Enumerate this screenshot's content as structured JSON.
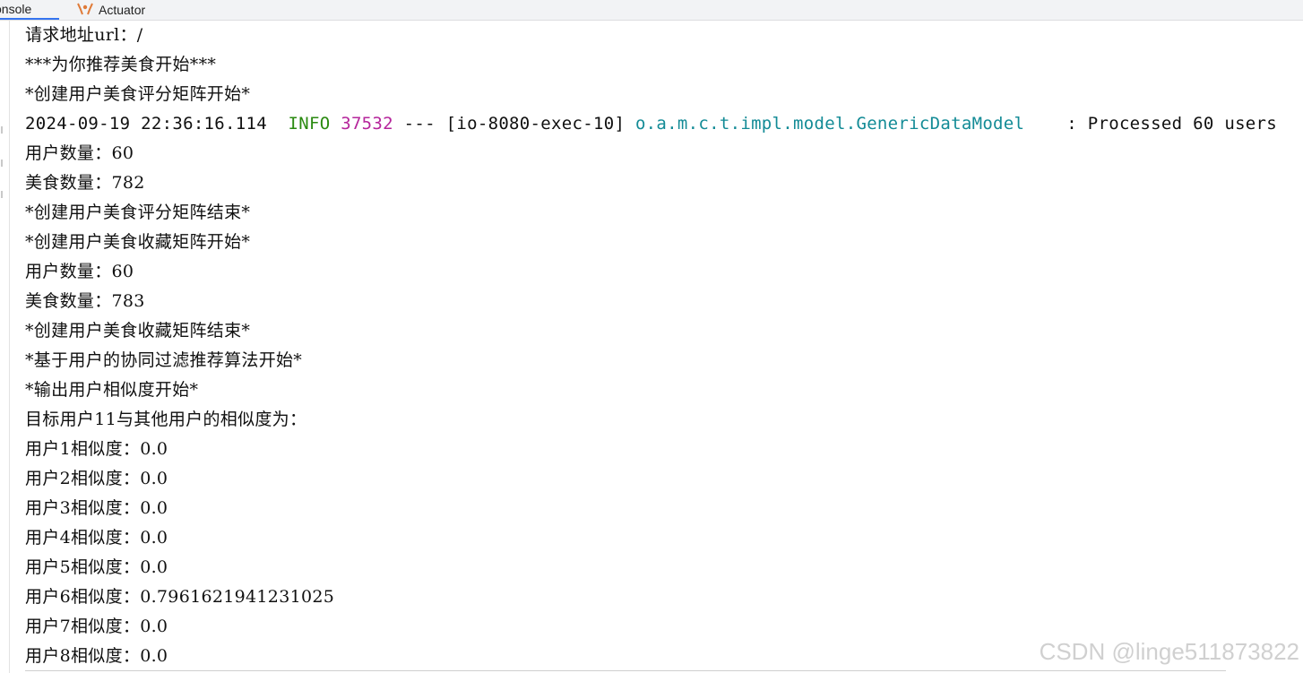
{
  "tabs": {
    "console_label": "onsole",
    "actuator_label": "Actuator"
  },
  "colors": {
    "info": "#2a8a10",
    "pid": "#b5259b",
    "logger": "#138b96",
    "tab_underline": "#3574f0"
  },
  "console": {
    "lines": [
      "请求地址url：/",
      "***为你推荐美食开始***",
      "*创建用户美食评分矩阵开始*",
      {
        "timestamp": "2024-09-19 22:36:16.114",
        "level": "INFO",
        "pid": "37532",
        "sep": "---",
        "thread": "[io-8080-exec-10]",
        "logger": "o.a.m.c.t.impl.model.GenericDataModel",
        "message": ": Processed 60 users"
      },
      "用户数量：60",
      "美食数量：782",
      "*创建用户美食评分矩阵结束*",
      "*创建用户美食收藏矩阵开始*",
      "用户数量：60",
      "美食数量：783",
      "*创建用户美食收藏矩阵结束*",
      "*基于用户的协同过滤推荐算法开始*",
      "*输出用户相似度开始*",
      "目标用户11与其他用户的相似度为：",
      "用户1相似度：0.0",
      "用户2相似度：0.0",
      "用户3相似度：0.0",
      "用户4相似度：0.0",
      "用户5相似度：0.0",
      "用户6相似度：0.7961621941231025",
      "用户7相似度：0.0",
      "用户8相似度：0.0"
    ]
  },
  "watermark": "CSDN @linge511873822"
}
